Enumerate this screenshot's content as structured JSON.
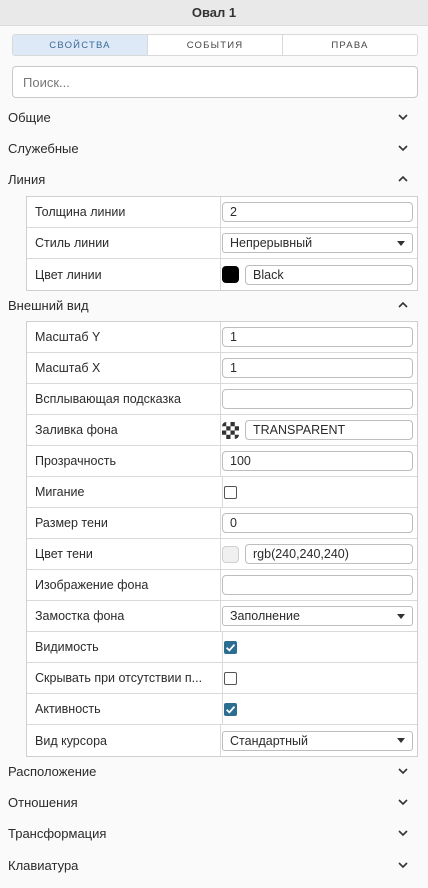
{
  "header": {
    "title": "Овал 1"
  },
  "tabs": [
    {
      "label": "СВОЙСТВА",
      "active": true
    },
    {
      "label": "СОБЫТИЯ",
      "active": false
    },
    {
      "label": "ПРАВА",
      "active": false
    }
  ],
  "search": {
    "placeholder": "Поиск..."
  },
  "sections": {
    "general": {
      "title": "Общие",
      "expanded": false
    },
    "service": {
      "title": "Служебные",
      "expanded": false
    },
    "line": {
      "title": "Линия",
      "expanded": true
    },
    "appearance": {
      "title": "Внешний вид",
      "expanded": true
    },
    "placement": {
      "title": "Расположение",
      "expanded": false
    },
    "relations": {
      "title": "Отношения",
      "expanded": false
    },
    "transform": {
      "title": "Трансформация",
      "expanded": false
    },
    "keyboard": {
      "title": "Клавиатура",
      "expanded": false
    }
  },
  "line": {
    "width": {
      "label": "Толщина линии",
      "value": "2"
    },
    "style": {
      "label": "Стиль линии",
      "value": "Непрерывный"
    },
    "color": {
      "label": "Цвет линии",
      "value": "Black",
      "swatch": "#000000"
    }
  },
  "appearance": {
    "scale_y": {
      "label": "Масштаб Y",
      "value": "1"
    },
    "scale_x": {
      "label": "Масштаб X",
      "value": "1"
    },
    "tooltip": {
      "label": "Всплывающая подсказка",
      "value": ""
    },
    "fill": {
      "label": "Заливка фона",
      "value": "TRANSPARENT"
    },
    "opacity": {
      "label": "Прозрачность",
      "value": "100"
    },
    "blink": {
      "label": "Мигание",
      "checked": false
    },
    "shadow_size": {
      "label": "Размер тени",
      "value": "0"
    },
    "shadow_color": {
      "label": "Цвет тени",
      "value": "rgb(240,240,240)",
      "swatch": "#f0f0f0"
    },
    "bg_image": {
      "label": "Изображение фона",
      "value": ""
    },
    "bg_tiling": {
      "label": "Замостка фона",
      "value": "Заполнение"
    },
    "visible": {
      "label": "Видимость",
      "checked": true
    },
    "hide_missing": {
      "label": "Скрывать при отсутствии п...",
      "checked": false
    },
    "active": {
      "label": "Активность",
      "checked": true
    },
    "cursor": {
      "label": "Вид курсора",
      "value": "Стандартный"
    }
  },
  "colors": {
    "accent": "#2c6e92",
    "tab_active_bg": "#dde9f6",
    "tab_active_text": "#3a6a98"
  }
}
